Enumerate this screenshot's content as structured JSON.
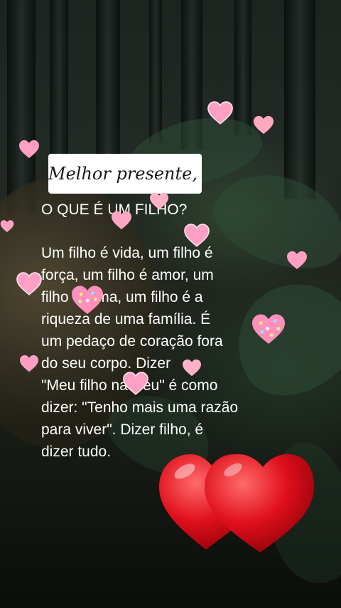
{
  "overlay": {
    "signature_text": "Melhor presente,",
    "heading": "O QUE É UM FILHO?",
    "body_lines": [
      "Um filho é vida, um filho é",
      "força, um filho é amor, um",
      "filho é alma, um filho é a",
      "riqueza de uma família. É",
      "um pedaço de coração fora",
      "do seu corpo. Dizer",
      "\"Meu filho nasceu\" é como",
      "dizer: \"Tenho mais uma razão",
      "para viver\". Dizer filho, é",
      "dizer tudo."
    ]
  },
  "colors": {
    "text": "#ffffff",
    "label_background": "#ffffff",
    "heart_red": "#e0101c",
    "sticker_pink": "#ff9fc4"
  },
  "icons": {
    "signature_heart": "red-heart-icon",
    "stickers": "pink-heart-sticker",
    "decoration": "red-hearts-pair"
  }
}
